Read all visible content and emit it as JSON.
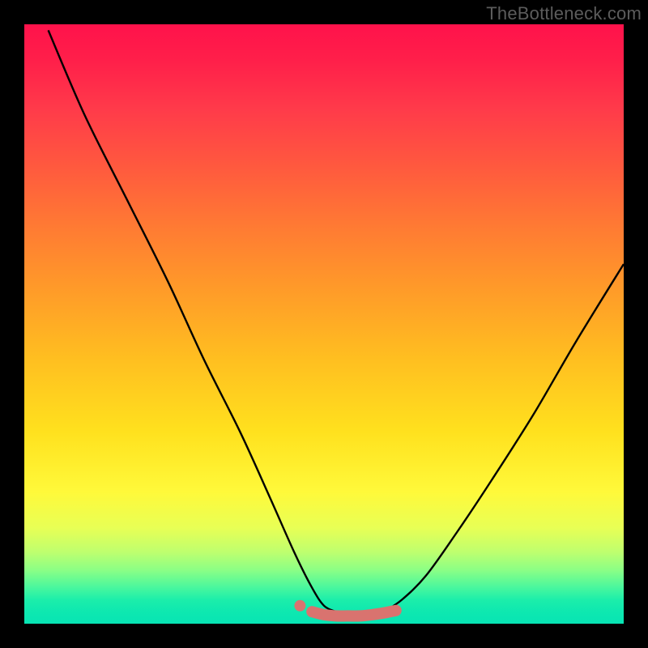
{
  "watermark": {
    "text": "TheBottleneck.com"
  },
  "chart_data": {
    "type": "line",
    "title": "",
    "xlabel": "",
    "ylabel": "",
    "xlim": [
      0,
      100
    ],
    "ylim": [
      0,
      100
    ],
    "series": [
      {
        "name": "left-curve",
        "x": [
          4,
          10,
          17,
          24,
          30,
          36,
          41,
          45,
          48,
          50,
          52
        ],
        "values": [
          99,
          85,
          71,
          57,
          44,
          32,
          21,
          12,
          6,
          3,
          2
        ]
      },
      {
        "name": "right-curve",
        "x": [
          60,
          63,
          67,
          72,
          78,
          85,
          92,
          100
        ],
        "values": [
          2,
          4,
          8,
          15,
          24,
          35,
          47,
          60
        ]
      },
      {
        "name": "valley-marker",
        "x": [
          48,
          50,
          52,
          54,
          56,
          58,
          60,
          62
        ],
        "values": [
          2,
          1.5,
          1.3,
          1.3,
          1.3,
          1.5,
          1.8,
          2.2
        ]
      }
    ],
    "annotations": []
  }
}
